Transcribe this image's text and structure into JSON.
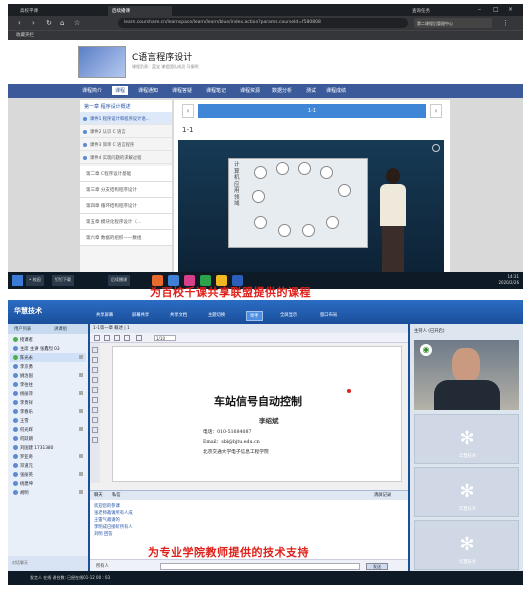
{
  "top": {
    "browser": {
      "tabs": [
        "高校平课",
        "后续播课",
        "查询任务"
      ],
      "url": "learn.courshare.cn/learnspace/learn/learn/blue/index.action?params.courseId=f580808",
      "extension": "第二课程后管理中心",
      "bookmark": "收藏夹栏"
    },
    "course": {
      "title": "C语言程序设计",
      "subtitle": "课程负责：蓝宝 课程团队成员 马振明",
      "nav": [
        "课程简介",
        "课程",
        "课程通知",
        "课程答疑",
        "课程笔记",
        "课程资源",
        "数据分析",
        "测试",
        "课程成绩"
      ],
      "chapter_header": "第一章 程序设计概述",
      "lessons": [
        "课件1 程序设计和程序设计语...",
        "课件2 认识 C 语言",
        "课件3 简单 C 语言程序",
        "课件4 实现问题的求解过程"
      ],
      "chapters": [
        "第二章 C程序设计基础",
        "第三章 分支结构程序设计",
        "第四章 循环结构程序设计",
        "第五章 模块化程序设计（...",
        "第六章 数据的组织——数组"
      ],
      "pager_label": "1-1",
      "section_title": "1-1",
      "video_text": "计算机应用领域"
    },
    "taskbar": {
      "items": [
        "• 校园",
        "钉钉下载",
        "后续播课"
      ],
      "clock_time": "14:31",
      "clock_date": "2020/2/26"
    },
    "caption": "为百校千课共享联盟提供的课程"
  },
  "bottom": {
    "app": {
      "logo": "华慧技术",
      "toolbar": [
        "共享屏幕",
        "屏幕共享",
        "共享文档",
        "主题切换",
        "举手",
        "全屏显示",
        "窗口布局"
      ],
      "left_tabs": [
        "用户列表",
        "讲课组"
      ],
      "users": [
        "授课者",
        "主席 主讲 张鑫烈 03",
        "陈光永",
        "李京勇",
        "姚治国",
        "李往往",
        "杨丽萍",
        "李贵祥",
        "李春乐",
        "王雪",
        "何光辉",
        "何跃朗",
        "刘国建 1731380",
        "罗亚奇",
        "邓道元",
        "张丽英",
        "杨建坤",
        "胡明"
      ],
      "left_input_placeholder": "对话聊天"
    },
    "doc": {
      "tabs": "1-1第一章 概述 | 1",
      "zoom": "1/10",
      "title": "车站信号自动控制",
      "author": "李绍斌",
      "phone": "电话：010-51684087",
      "email": "Email：sbl@bjtu.edu.cn",
      "affiliation": "北京交通大学电子信息工程学院"
    },
    "chat": {
      "tabs": [
        "聊天",
        "私信"
      ],
      "clear": "清屏记录",
      "lines": [
        "欢迎您的参课",
        "张老师邀请所有人成",
        "王雷气邀请的",
        "李明成已接听所有人",
        "刘明 回答"
      ],
      "to_label": "所有人",
      "send": "发送"
    },
    "right": {
      "header": "主持人 (已开启)",
      "placeholder_label": "华慧技术"
    },
    "status": "发言人 在线 讲台数: 已经在线01-12  00 : 03",
    "caption": "为专业学院教师提供的技术支持"
  }
}
